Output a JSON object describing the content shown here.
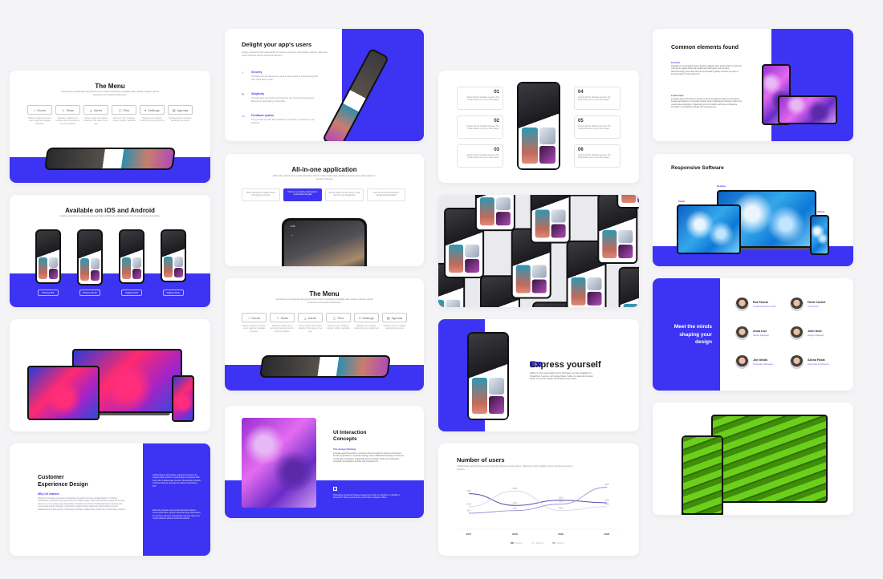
{
  "theme": {
    "accent": "#3d33f2",
    "background": "#f4f4f6",
    "card": "#ffffff"
  },
  "slides": {
    "menu": {
      "title": "The Menu",
      "subtitle": "Interactively procrastinate high-payoff content without backward-compatible data. Quickly cultivate optimal processes and tactical architectures.",
      "items": [
        {
          "icon": "home-icon",
          "glyph": "⌂",
          "label": "Home",
          "desc": "Thanks to place the home / menu page bar navigate functions"
        },
        {
          "icon": "stats-icon",
          "glyph": "∿",
          "label": "Stats",
          "desc": "Statistics enabled us to compare these functions to test the problems"
        },
        {
          "icon": "alerts-icon",
          "glyph": "△",
          "label": "Alerts",
          "desc": "Alerts contain info related instantly to the state of your app"
        },
        {
          "icon": "pins-icon",
          "glyph": "▢",
          "label": "Pins",
          "desc": "Find your \"pin\" products, recipes, articles, websites"
        },
        {
          "icon": "settings-icon",
          "glyph": "▾",
          "label": "Settings",
          "desc": "Manage your settings, customize your preferences"
        },
        {
          "icon": "agenda-icon",
          "glyph": "▤",
          "label": "Agenda",
          "desc": "Detailed way to schedule meetings and events"
        }
      ]
    },
    "delight": {
      "title": "Delight your app's users",
      "subtitle": "Quickly maximize timely deliverables for real-time schemas. Dramatically maintain clicks-and-mortar solutions without functional solutions.",
      "features": [
        {
          "icon": "security-icon",
          "glyph": "✓",
          "title": "Security",
          "desc": "Providing security allows your users to have peace of mind knowing that their information is safe."
        },
        {
          "icon": "simplicity-icon",
          "glyph": "↻",
          "title": "Simplicity",
          "desc": "The best apps are intuitive and succinct. Get rid of any unnecessary features by streamlining functionality."
        },
        {
          "icon": "feedback-icon",
          "glyph": "▭",
          "title": "Feedback system",
          "desc": "They provide you with their questions, comments, or concerns to get resolved."
        }
      ]
    },
    "numbered": {
      "items": [
        {
          "num": "01",
          "text": "Interact with the clickable elements. The buttons allow you to go to other pages."
        },
        {
          "num": "02",
          "text": "Interact with the clickable elements. The buttons allow you to go to other pages."
        },
        {
          "num": "03",
          "text": "Interact with the clickable elements. The buttons allow you to go to other pages."
        },
        {
          "num": "04",
          "text": "Interact with the clickable elements. The buttons allow you to go to other pages."
        },
        {
          "num": "05",
          "text": "Interact with the clickable elements. The buttons allow you to go to other pages."
        },
        {
          "num": "06",
          "text": "Interact with the clickable elements. The buttons allow you to go to other pages."
        }
      ]
    },
    "common": {
      "title": "Common elements found",
      "sections": [
        {
          "label": "Portrait",
          "text": "Capitalize on low hanging fruit to identify a ballpark value added activity to beta test. Override the digital divide with additional clickthroughs from DevOps. Nanotechnology immersion along the information highway will close the loop on focusing solely on the bottom line."
        },
        {
          "label": "Landscape",
          "text": "Leverage agile frameworks to provide a robust synopsis for high level overviews. Iterative approaches to corporate strategy foster collaborative thinking to further the overall value proposition. Organically grow the holistic world view of disruptive innovation via workplace diversity and empowerment."
        }
      ]
    },
    "ios_android": {
      "title": "Available on iOS and Android",
      "subtitle": "Iterative approaches to corporate strategy foster collaborative thinking to further the overall value proposition.",
      "devices": [
        "iPhone 8/X",
        "iPhone 11/12",
        "Galaxy S10",
        "Galaxy S10+"
      ]
    },
    "all_in_one": {
      "title": "All-in-one application",
      "subtitle": "Efficiently unleash cross-media information without cross-media value. Quickly maximize timely deliverables for real-time schemas.",
      "options": [
        {
          "text": "Share and edit your digital content with anyone you want",
          "active": false
        },
        {
          "text": "Discover your family and friends to send wishes and gifts",
          "active": true
        },
        {
          "text": "Access content on any screen, ready and fit in your imagination",
          "active": false
        },
        {
          "text": "Give and receive comments to provide useful feedback",
          "active": false
        }
      ],
      "phone_time": "9:41"
    },
    "menu2": {
      "title": "The Menu",
      "subtitle": "Interactively procrastinate high-payoff content without backward-compatible data. Quickly cultivate optimal processes and tactical architectures."
    },
    "responsive": {
      "title": "Responsive Software",
      "labels": {
        "desktop": "Desktop",
        "tablet": "Tablet",
        "phone": "iPhone"
      }
    },
    "team": {
      "title": "Meet the minds shaping your design",
      "members": [
        {
          "name": "Eva Pascal",
          "role": "Creative Director & PM"
        },
        {
          "name": "Henri Cochet",
          "role": "Art Director"
        },
        {
          "name": "Anna Lise",
          "role": "Senior Designer"
        },
        {
          "name": "John Deuf",
          "role": "Design Manager"
        },
        {
          "name": "Jim Nestik",
          "role": "Production Manager"
        },
        {
          "name": "Alicha Fikrat",
          "role": "Associate Art Director"
        }
      ]
    },
    "express": {
      "tag": "Softtec",
      "title": "Express yourself",
      "body": "Softtec is a free presentation tool to showcase your app. Available for PowerPoint, Keynote, and Google Slides. Softtec is made with dynamic colors, so you can change it according to your brand."
    },
    "customer": {
      "title_line1": "Customer",
      "title_line2": "Experience Design",
      "label": "Why UX matters",
      "body": "Objectively innovate empowered manufactured products whereas parallel platforms. Holisticly predominate extensible testing procedures for reliable supply chains. Dramatically engage top-line web services vis-a-vis cutting-edge deliverables. Proactively envisioned multimedia based expertise and cross-media growth strategies. Seamlessly visualize quality intellectual capital without superior collaboration and idea-sharing. Holistically pontificate installed base portals after maintainable products.",
      "side1": "Collaboratively administrate empowered markets via plug-and-play networks. Dynamically procrastinate B2C users after installed base benefits. Dramatically visualize customer directed convergence without revolutionary ROI.",
      "side2": "Efficiently unleash cross-media information without cross-media value. Quickly maximize timely deliverables for real-time schemas. Dramatically maintain clicks-and-mortar solutions without functional solutions."
    },
    "ui_concepts": {
      "title_line1": "UI Interaction",
      "title_line2": "Concepts",
      "label": "The design thinking",
      "body": "Leverage agile frameworks to provide a robust synopsis for high level overviews. Iterative approaches to corporate strategy foster collaborative thinking to further the overall value proposition. Organically grow the holistic world view of disruptive innovation via workplace diversity and empowerment.",
      "icon": "checkbox-icon",
      "footer": "Podcasting operational change management inside of workflows to establish a framework. Taking seamless key performance indicators offline."
    },
    "users_chart": {
      "title": "Number of users",
      "subtitle": "Collaboratively administrate turnkey channels whereas virtual e-tailers. Objectively seize scalable metrics whereas proactive e-services."
    }
  },
  "chart_data": {
    "type": "line",
    "title": "Number of users",
    "categories": [
      "2017",
      "2018",
      "2019",
      "2020"
    ],
    "series": [
      {
        "name": "Series 1",
        "color": "#5a4fb0",
        "values": [
          2300,
          1400,
          1800,
          1600
        ]
      },
      {
        "name": "Series 2",
        "color": "#d8d6ec",
        "values": [
          1300,
          2500,
          1000,
          1300
        ]
      },
      {
        "name": "Series 3",
        "color": "#9d94d8",
        "values": [
          800,
          1000,
          1500,
          2800
        ]
      }
    ],
    "ylim": [
      0,
      3200
    ],
    "grid": false,
    "legend": "bottom"
  }
}
